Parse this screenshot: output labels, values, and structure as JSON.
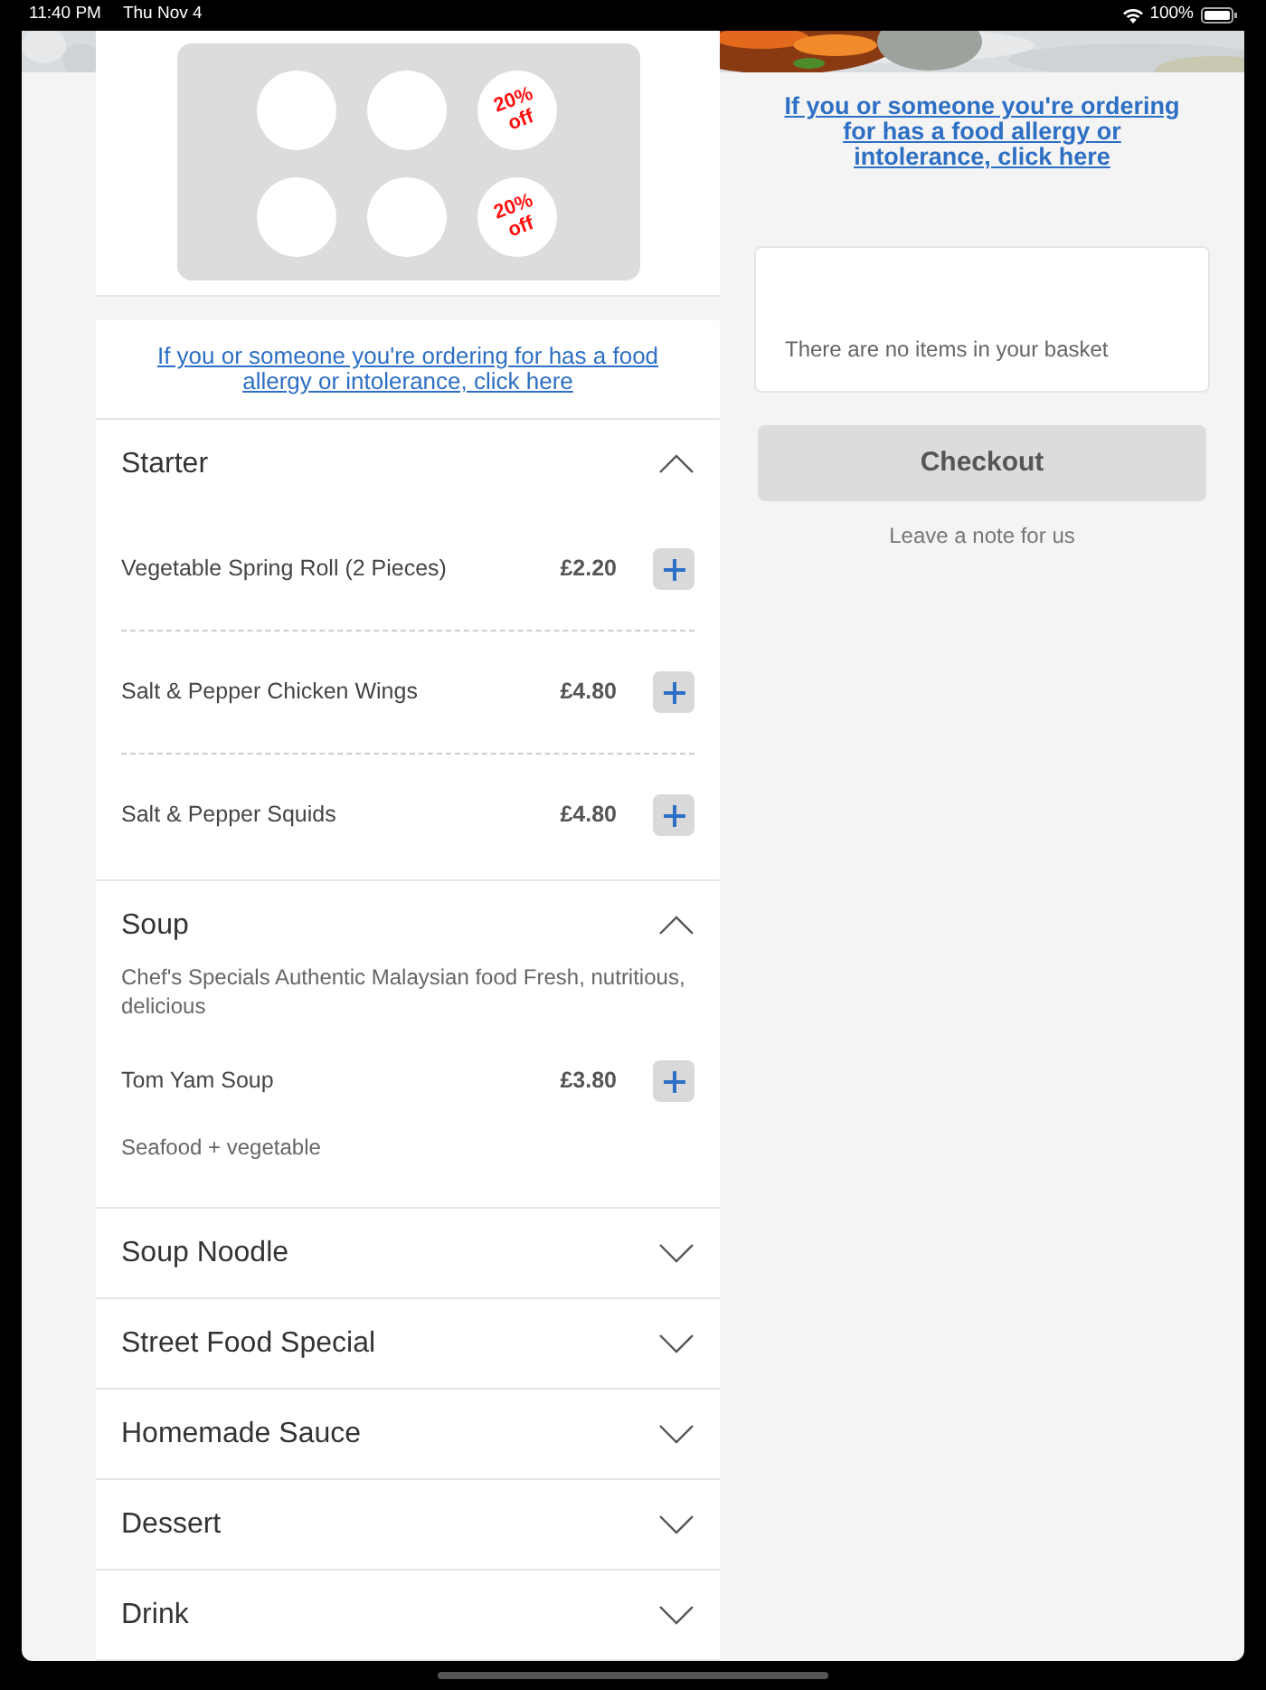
{
  "status_bar": {
    "time": "11:40 PM",
    "date": "Thu Nov 4",
    "battery": "100%"
  },
  "loyalty_card": {
    "stamps": [
      {
        "kind": "blank"
      },
      {
        "kind": "blank"
      },
      {
        "kind": "discount",
        "label": "20% off"
      },
      {
        "kind": "blank"
      },
      {
        "kind": "blank"
      },
      {
        "kind": "discount",
        "label": "20% off"
      }
    ]
  },
  "allergy_link": "If you or someone you're ordering for has a food allergy or intolerance, click here",
  "categories": [
    {
      "name": "Starter",
      "expanded": true,
      "items": [
        {
          "name": "Vegetable Spring Roll (2 Pieces)",
          "price": "£2.20"
        },
        {
          "name": "Salt & Pepper Chicken Wings",
          "price": "£4.80"
        },
        {
          "name": "Salt & Pepper Squids",
          "price": "£4.80"
        }
      ]
    },
    {
      "name": "Soup",
      "expanded": true,
      "description": "Chef's Specials Authentic Malaysian food Fresh, nutritious, delicious",
      "items": [
        {
          "name": "Tom Yam Soup",
          "price": "£3.80",
          "note": "Seafood + vegetable"
        }
      ]
    },
    {
      "name": "Soup Noodle",
      "expanded": false
    },
    {
      "name": "Street Food Special",
      "expanded": false
    },
    {
      "name": "Homemade Sauce",
      "expanded": false
    },
    {
      "name": "Dessert",
      "expanded": false
    },
    {
      "name": "Drink",
      "expanded": false
    }
  ],
  "basket": {
    "allergy_link": "If you or someone you're ordering for has a food allergy or intolerance, click here",
    "empty_text": "There are no items in your basket",
    "checkout": "Checkout",
    "note_link": "Leave a note for us"
  }
}
